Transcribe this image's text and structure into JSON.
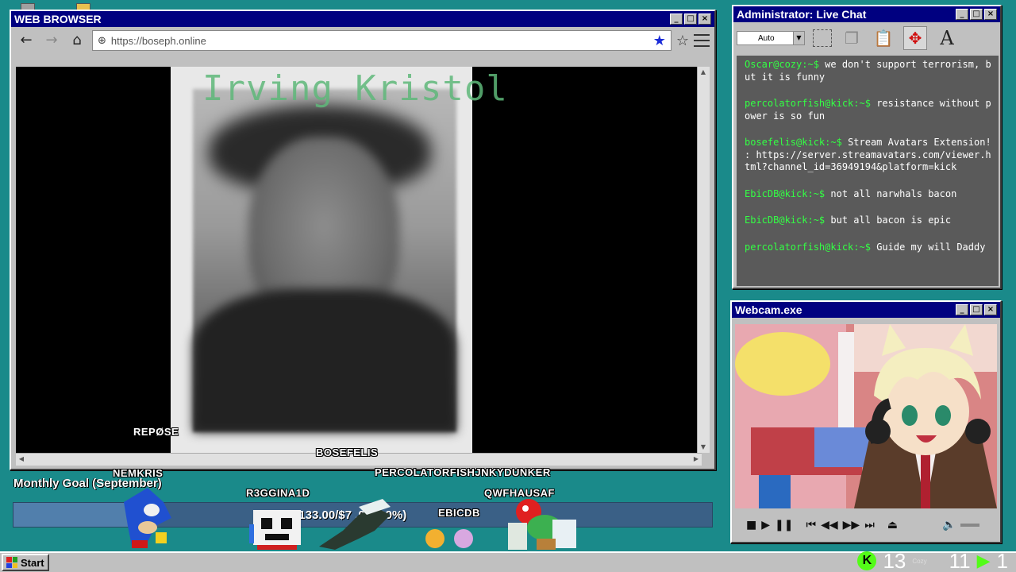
{
  "browser": {
    "title": "WEB BROWSER",
    "url": "https://boseph.online",
    "page_heading": "Irving Kristol"
  },
  "chat": {
    "title": "Administrator: Live Chat",
    "font_select": "Auto",
    "messages": [
      {
        "user": "Oscar@cozy:~$",
        "text": "we don't support terrorism, but it is funny"
      },
      {
        "user": "percolatorfish@kick:~$",
        "text": "resistance without power is so fun"
      },
      {
        "user": "bosefelis@kick:~$",
        "text": "Stream Avatars Extension! : https://server.streamavatars.com/viewer.html?channel_id=36949194&platform=kick"
      },
      {
        "user": "EbicDB@kick:~$",
        "text": "not all narwhals bacon"
      },
      {
        "user": "EbicDB@kick:~$",
        "text": "but all bacon is epic"
      },
      {
        "user": "percolatorfish@kick:~$",
        "text": "Guide my will Daddy"
      }
    ]
  },
  "webcam": {
    "title": "Webcam.exe"
  },
  "goal": {
    "label": "Monthly Goal (September)",
    "amount_text": "$133.00/$7   .00 (19%)",
    "percent": 19
  },
  "avatars": {
    "repose": "REPØSE",
    "bosefelis": "BOSEFELIS",
    "nemkris": "NEMKRIS",
    "r3gginald": "R3GGINA1D",
    "percolator": "PERCOLATORFISHJNKYDUNKER",
    "qwfhausaf": "QWFHAUSAF",
    "ebicdb": "EBICDB"
  },
  "taskbar": {
    "start_label": "Start",
    "tray_count_1": "13",
    "tray_count_2": "11",
    "tray_count_3": "1",
    "tray_app": "Cozy"
  },
  "colors": {
    "desktop": "#1a8a8a",
    "titlebar": "#000080",
    "chat_user": "#33ff44",
    "kick_green": "#53fc18"
  }
}
